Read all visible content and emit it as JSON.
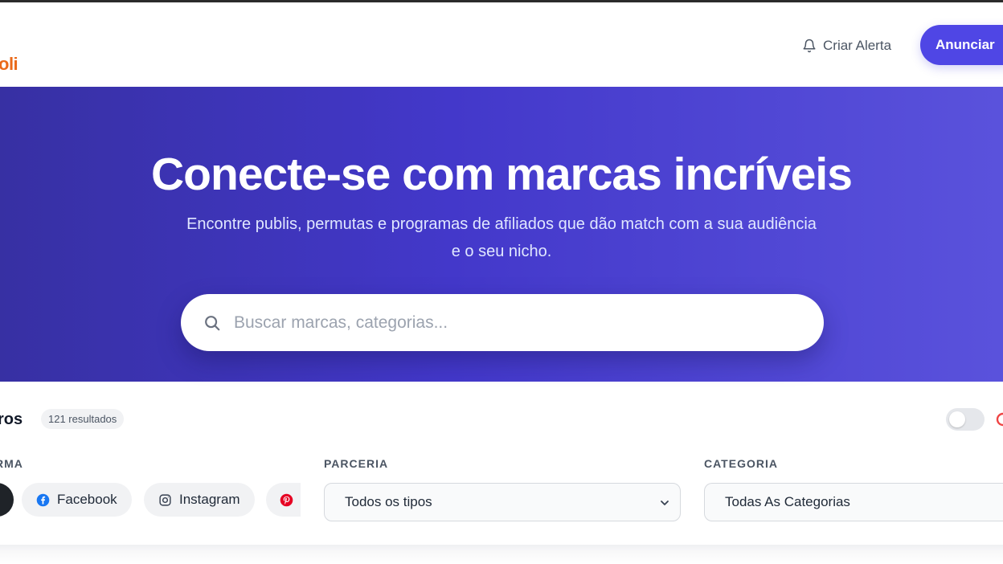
{
  "header": {
    "logo_text": "oli",
    "alert_label": "Criar Alerta",
    "announce_label": "Anunciar",
    "brand_color": "#4f46e5",
    "logo_color": "#ea6a1a"
  },
  "hero": {
    "title": "Conecte-se com marcas incríveis",
    "subtitle": "Encontre publis, permutas e programas de afiliados que dão match com a sua audiência e o seu nicho.",
    "search_placeholder": "Buscar marcas, categorias...",
    "search_value": ""
  },
  "filters": {
    "title": "ros",
    "results_count": "121 resultados",
    "platform_label": "RMA",
    "platform_chips": [
      {
        "label": "Facebook",
        "icon": "facebook-icon"
      },
      {
        "label": "Instagram",
        "icon": "instagram-icon"
      },
      {
        "label": "",
        "icon": "pinterest-icon"
      }
    ],
    "partnership_label": "PARCERIA",
    "partnership_value": "Todos os tipos",
    "category_label": "CATEGORIA",
    "category_value": "Todas As Categorias"
  }
}
